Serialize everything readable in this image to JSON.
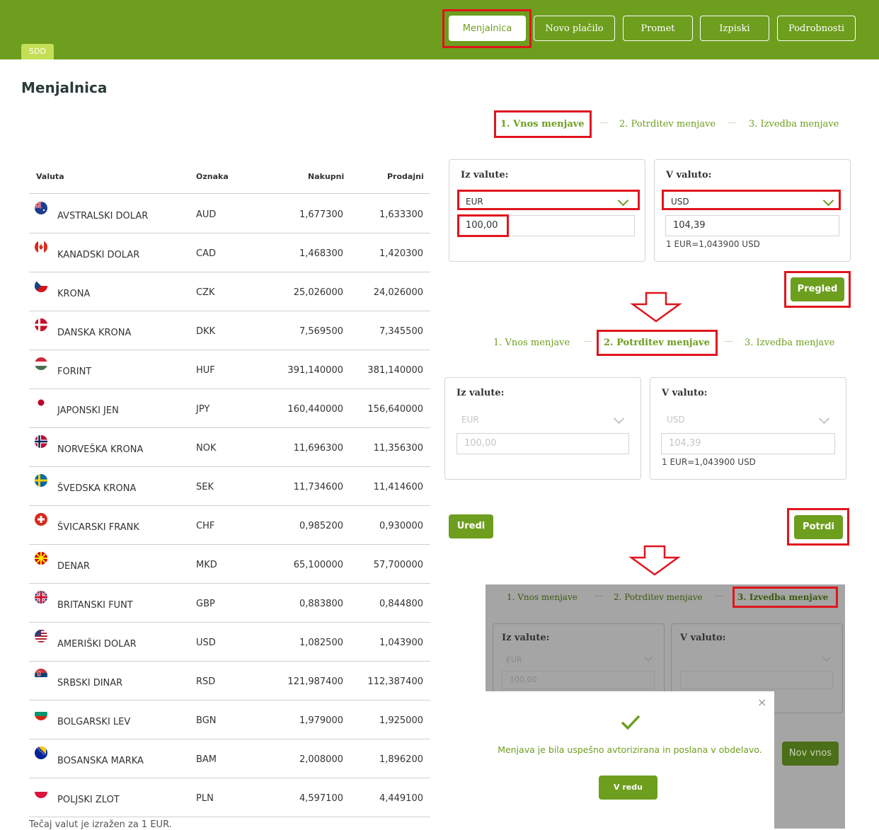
{
  "header": {
    "tag": "SDD",
    "nav": [
      "Menjalnica",
      "Novo plačilo",
      "Promet",
      "Izpiski",
      "Podrobnosti"
    ]
  },
  "page_title": "Menjalnica",
  "table": {
    "headers": [
      "Valuta",
      "Oznaka",
      "Nakupni",
      "Prodajni"
    ],
    "rows": [
      {
        "name": "AVSTRALSKI DOLAR",
        "code": "AUD",
        "buy": "1,677300",
        "sell": "1,633300",
        "flag": "australia-flag-icon"
      },
      {
        "name": "KANADSKI DOLAR",
        "code": "CAD",
        "buy": "1,468300",
        "sell": "1,420300",
        "flag": "canada-flag-icon"
      },
      {
        "name": "KRONA",
        "code": "CZK",
        "buy": "25,026000",
        "sell": "24,026000",
        "flag": "czech-flag-icon"
      },
      {
        "name": "DANSKA KRONA",
        "code": "DKK",
        "buy": "7,569500",
        "sell": "7,345500",
        "flag": "denmark-flag-icon"
      },
      {
        "name": "FORINT",
        "code": "HUF",
        "buy": "391,140000",
        "sell": "381,140000",
        "flag": "hungary-flag-icon"
      },
      {
        "name": "JAPONSKI JEN",
        "code": "JPY",
        "buy": "160,440000",
        "sell": "156,640000",
        "flag": "japan-flag-icon"
      },
      {
        "name": "NORVEŠKA KRONA",
        "code": "NOK",
        "buy": "11,696300",
        "sell": "11,356300",
        "flag": "norway-flag-icon"
      },
      {
        "name": "ŠVEDSKA KRONA",
        "code": "SEK",
        "buy": "11,734600",
        "sell": "11,414600",
        "flag": "sweden-flag-icon"
      },
      {
        "name": "ŠVICARSKI FRANK",
        "code": "CHF",
        "buy": "0,985200",
        "sell": "0,930000",
        "flag": "switzerland-flag-icon"
      },
      {
        "name": "DENAR",
        "code": "MKD",
        "buy": "65,100000",
        "sell": "57,700000",
        "flag": "macedonia-flag-icon"
      },
      {
        "name": "BRITANSKI FUNT",
        "code": "GBP",
        "buy": "0,883800",
        "sell": "0,844800",
        "flag": "uk-flag-icon"
      },
      {
        "name": "AMERIŠKI DOLAR",
        "code": "USD",
        "buy": "1,082500",
        "sell": "1,043900",
        "flag": "usa-flag-icon"
      },
      {
        "name": "SRBSKI DINAR",
        "code": "RSD",
        "buy": "121,987400",
        "sell": "112,387400",
        "flag": "serbia-flag-icon"
      },
      {
        "name": "BOLGARSKI LEV",
        "code": "BGN",
        "buy": "1,979000",
        "sell": "1,925000",
        "flag": "bulgaria-flag-icon"
      },
      {
        "name": "BOSANSKA MARKA",
        "code": "BAM",
        "buy": "2,008000",
        "sell": "1,896200",
        "flag": "bosnia-flag-icon"
      },
      {
        "name": "POLJSKI ZLOT",
        "code": "PLN",
        "buy": "4,597100",
        "sell": "4,449100",
        "flag": "poland-flag-icon"
      }
    ],
    "note": "Tečaj valut je izražen za 1 EUR."
  },
  "steps": [
    "1. Vnos menjave",
    "2. Potrditev menjave",
    "3. Izvedba menjave"
  ],
  "form": {
    "from_label": "Iz valute:",
    "to_label": "V valuto:",
    "from_currency": "EUR",
    "to_currency": "USD",
    "amount": "100,00",
    "converted": "104,39",
    "rate": "1 EUR=1,043900 USD",
    "preview_button": "Pregled",
    "edit_button": "Uredi",
    "confirm_button": "Potrdi",
    "new_entry_button": "Nov vnos"
  },
  "modal": {
    "message": "Menjava je bila uspešno avtorizirana in poslana v obdelavo.",
    "ok_button": "V redu",
    "close": "×"
  },
  "colors": {
    "brand": "#6d9e1e",
    "highlight": "#e0151d"
  }
}
